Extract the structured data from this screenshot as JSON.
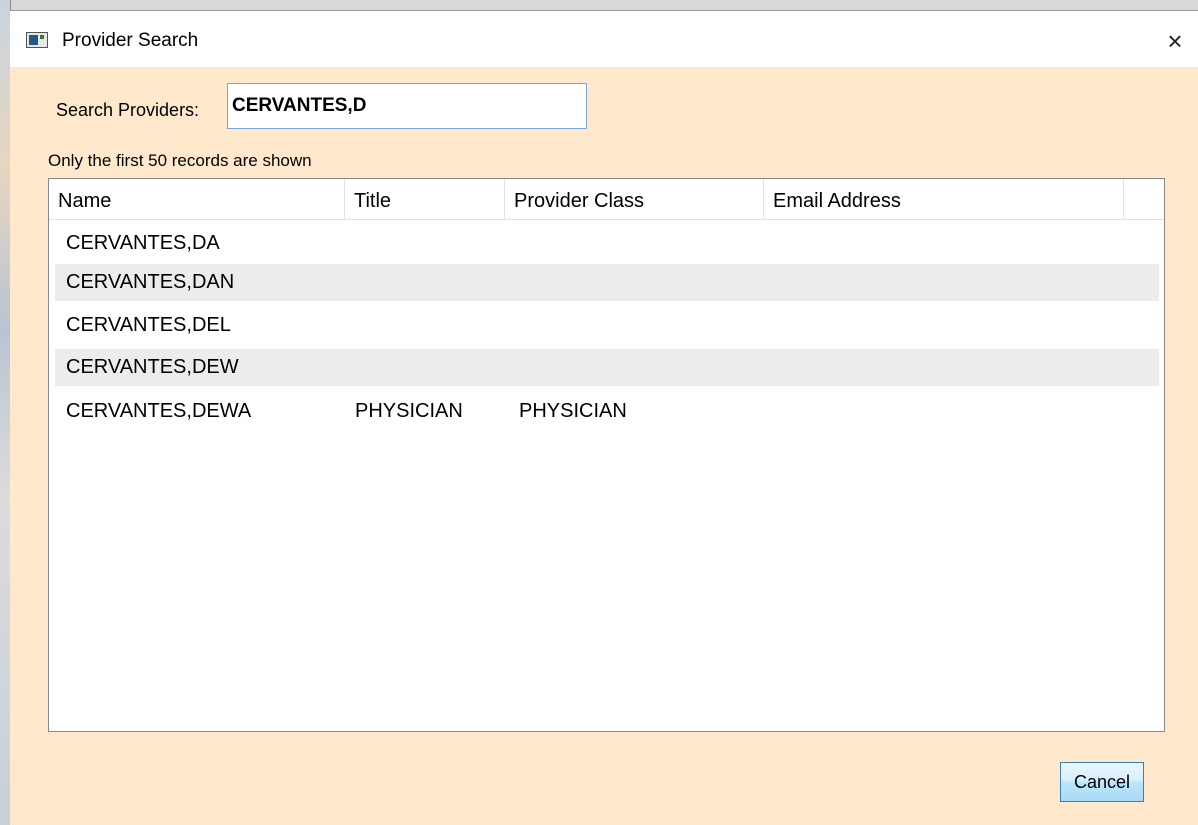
{
  "window": {
    "title": "Provider Search",
    "close_symbol": "×"
  },
  "search": {
    "label": "Search Providers:",
    "value": "CERVANTES,D"
  },
  "notice": "Only the first 50 records are shown",
  "table": {
    "columns": [
      "Name",
      "Title",
      "Provider Class",
      "Email Address"
    ],
    "rows": [
      {
        "name": "CERVANTES,DA",
        "title": "",
        "provider_class": "",
        "email": ""
      },
      {
        "name": "CERVANTES,DAN",
        "title": "",
        "provider_class": "",
        "email": ""
      },
      {
        "name": "CERVANTES,DEL",
        "title": "",
        "provider_class": "",
        "email": ""
      },
      {
        "name": "CERVANTES,DEW",
        "title": "",
        "provider_class": "",
        "email": ""
      },
      {
        "name": "CERVANTES,DEWA",
        "title": "PHYSICIAN",
        "provider_class": "PHYSICIAN",
        "email": ""
      }
    ]
  },
  "buttons": {
    "cancel": "Cancel"
  },
  "icons": {
    "app": "app-window-icon",
    "close": "close-icon"
  },
  "colors": {
    "dialog_background": "#ffe8cc",
    "alternate_row": "#ececec",
    "input_border": "#7aa7d6",
    "button_border": "#3c7fb1"
  }
}
